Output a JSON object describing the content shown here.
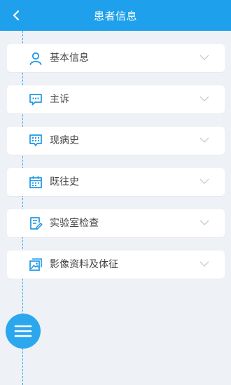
{
  "header": {
    "title": "患者信息",
    "back_icon": "chevron-left-icon"
  },
  "colors": {
    "primary": "#1ea0ec",
    "icon": "#1d97e8",
    "chevron": "#c8ccd2",
    "background": "#eef1f5"
  },
  "sections": [
    {
      "label": "基本信息",
      "icon": "person-icon"
    },
    {
      "label": "主诉",
      "icon": "chat-bubble-icon"
    },
    {
      "label": "现病史",
      "icon": "grid-chat-icon"
    },
    {
      "label": "既往史",
      "icon": "calendar-icon"
    },
    {
      "label": "实验室检查",
      "icon": "clipboard-edit-icon"
    },
    {
      "label": "影像资料及体征",
      "icon": "image-gallery-icon"
    }
  ],
  "fab": {
    "icon": "hamburger-menu-icon"
  }
}
